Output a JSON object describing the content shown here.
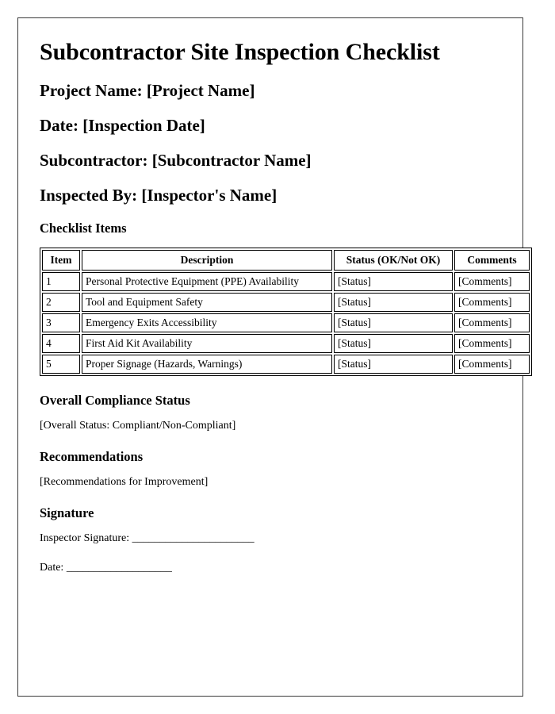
{
  "document": {
    "title": "Subcontractor Site Inspection Checklist",
    "fields": [
      {
        "label": "Project Name:",
        "value": "[Project Name]",
        "name": "project-name"
      },
      {
        "label": "Date:",
        "value": "[Inspection Date]",
        "name": "inspection-date"
      },
      {
        "label": "Subcontractor:",
        "value": "[Subcontractor Name]",
        "name": "subcontractor-name"
      },
      {
        "label": "Inspected By:",
        "value": "[Inspector's Name]",
        "name": "inspector-name"
      }
    ],
    "field_lines": [
      "Project Name: [Project Name]",
      "Date: [Inspection Date]",
      "Subcontractor: [Subcontractor Name]",
      "Inspected By: [Inspector's Name]"
    ],
    "checklist": {
      "heading": "Checklist Items",
      "columns": [
        "Item",
        "Description",
        "Status (OK/Not OK)",
        "Comments"
      ],
      "rows": [
        {
          "item": "1",
          "description": "Personal Protective Equipment (PPE) Availability",
          "status": "[Status]",
          "comments": "[Comments]"
        },
        {
          "item": "2",
          "description": "Tool and Equipment Safety",
          "status": "[Status]",
          "comments": "[Comments]"
        },
        {
          "item": "3",
          "description": "Emergency Exits Accessibility",
          "status": "[Status]",
          "comments": "[Comments]"
        },
        {
          "item": "4",
          "description": "First Aid Kit Availability",
          "status": "[Status]",
          "comments": "[Comments]"
        },
        {
          "item": "5",
          "description": "Proper Signage (Hazards, Warnings)",
          "status": "[Status]",
          "comments": "[Comments]"
        }
      ]
    },
    "compliance": {
      "heading": "Overall Compliance Status",
      "value": "[Overall Status: Compliant/Non-Compliant]"
    },
    "recommendations": {
      "heading": "Recommendations",
      "value": "[Recommendations for Improvement]"
    },
    "signature": {
      "heading": "Signature",
      "inspector_label": "Inspector Signature: ______________________",
      "date_label": "Date: ___________________"
    }
  },
  "colors": {
    "page_border": "#3a3a3a",
    "table_border": "#000000",
    "text": "#000000",
    "background": "#ffffff"
  }
}
